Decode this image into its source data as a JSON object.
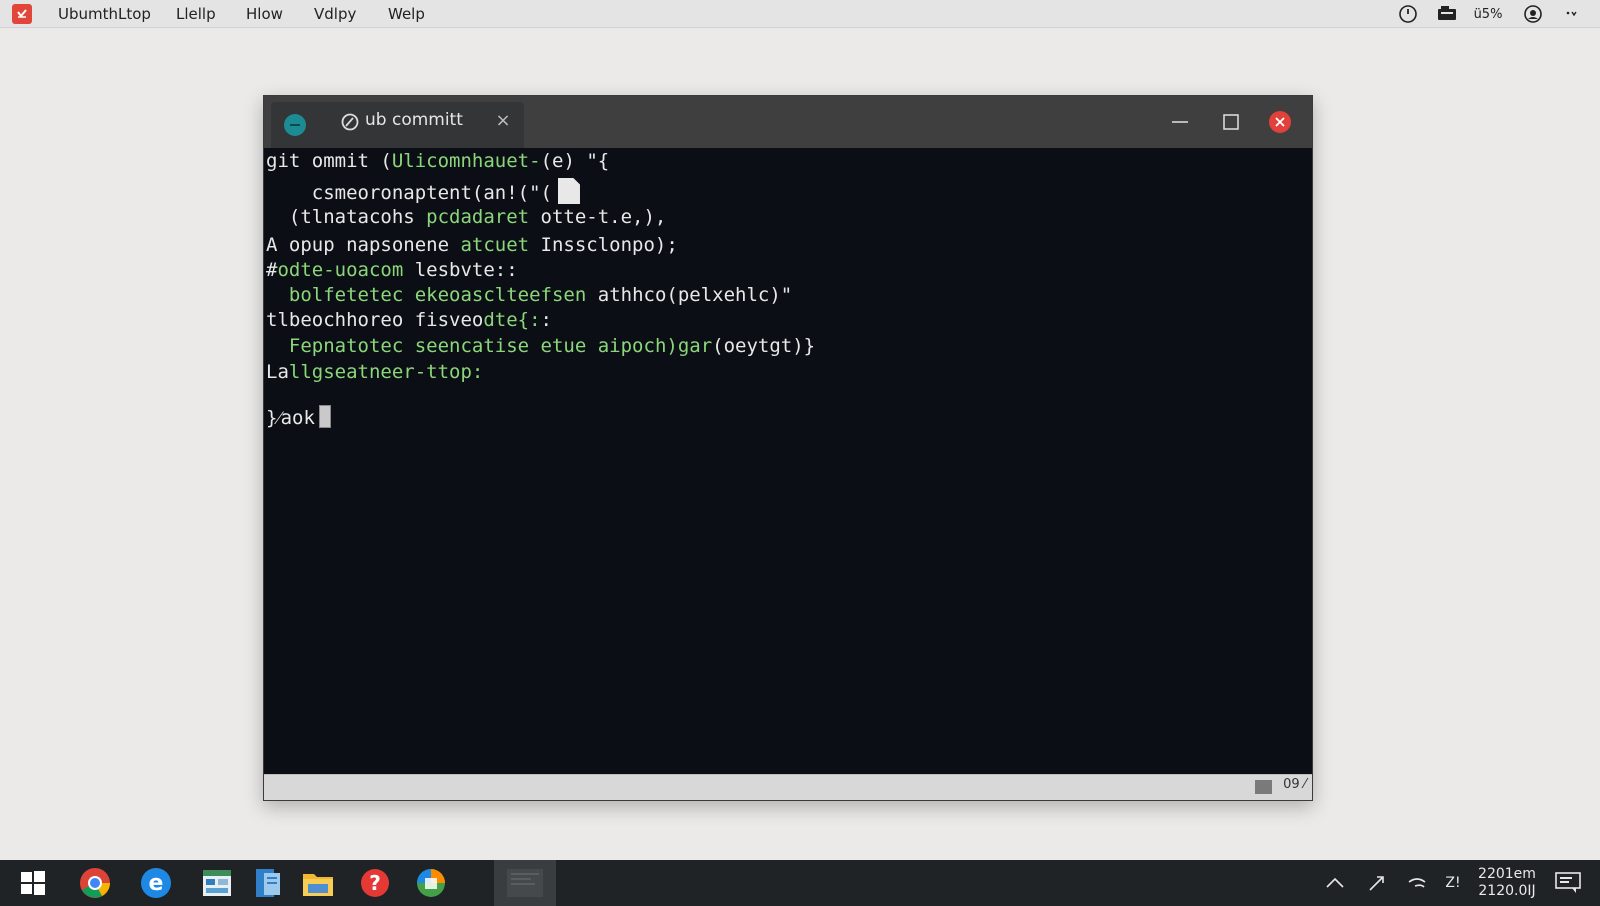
{
  "menubar": {
    "items": [
      "UbumthLtop",
      "Llellp",
      "Hlow",
      "Vdlpy",
      "Welp"
    ],
    "status": {
      "power_icon": "power-icon",
      "battery_text": "ü5%",
      "battery_label": "ü5%"
    }
  },
  "window": {
    "tab_title": "ub committ",
    "tab_close": "×",
    "controls": [
      "minimize",
      "maximize",
      "close"
    ],
    "status_text": "09 ⁄"
  },
  "terminal": {
    "lines": [
      [
        "git ommit (",
        "Ulicomnhauet-",
        "(e) ",
        "\"{"
      ],
      [
        "    csmeoronaptent(an!(\"("
      ],
      [
        "  (tlnatacohs ",
        "pcdadaret ",
        "otte-t.e,),"
      ],
      [
        "A opup napsonene ",
        "atcuet ",
        "Inssclonpo);"
      ],
      [
        "#",
        "odte-uoacom ",
        "lesbvte:",
        ":"
      ],
      [
        "  ",
        "bolfetetec ekeoasclteefsen ",
        "athhco(pe",
        "lx",
        "ehlc)\""
      ],
      [
        "tlbeochhoreo fisveo",
        "dte{:",
        ":"
      ],
      [
        "  ",
        "Fepnatotec seencatise etue aipoch)gar",
        "(oeytgt)}"
      ],
      [
        "La",
        "llgseatneer-ttop:"
      ],
      [
        "}⁄aok"
      ]
    ]
  },
  "taskbar": {
    "clock_time": "2201em",
    "clock_date": "2120.0IJ",
    "tray_text": "Z!"
  }
}
